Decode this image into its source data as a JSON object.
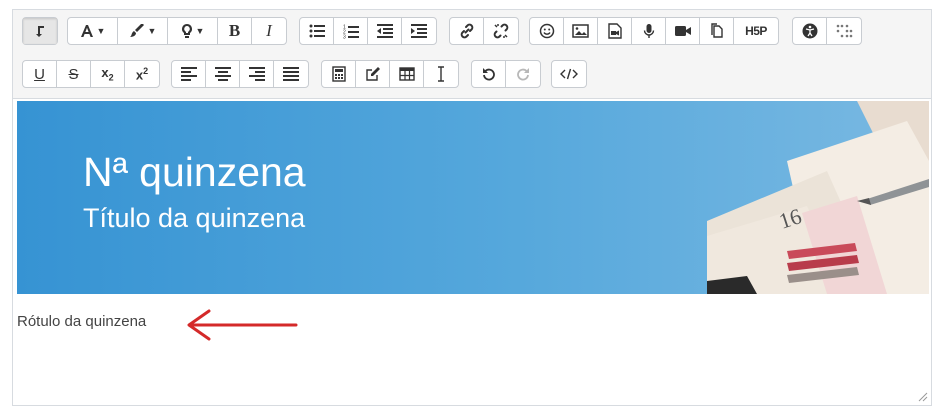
{
  "toolbar": {
    "row1": [
      {
        "name": "toolbar-toggle-button",
        "icon": "toolbar-toggle-icon",
        "pressed": true
      },
      {
        "name": "font-color-button",
        "icon": "font-color-icon"
      },
      {
        "name": "background-color-button",
        "icon": "paintbrush-icon"
      },
      {
        "name": "styles-button",
        "icon": "lightbulb-icon"
      },
      {
        "name": "bold-button",
        "icon": "bold-icon"
      },
      {
        "name": "italic-button",
        "icon": "italic-icon"
      },
      {
        "name": "unordered-list-button",
        "icon": "bullet-list-icon"
      },
      {
        "name": "ordered-list-button",
        "icon": "numbered-list-icon"
      },
      {
        "name": "outdent-button",
        "icon": "outdent-icon"
      },
      {
        "name": "indent-button",
        "icon": "indent-icon"
      },
      {
        "name": "link-button",
        "icon": "link-icon"
      },
      {
        "name": "unlink-button",
        "icon": "unlink-icon"
      },
      {
        "name": "emoji-button",
        "icon": "smiley-icon"
      },
      {
        "name": "image-button",
        "icon": "image-icon"
      },
      {
        "name": "media-button",
        "icon": "media-file-icon"
      },
      {
        "name": "record-audio-button",
        "icon": "microphone-icon"
      },
      {
        "name": "record-video-button",
        "icon": "video-camera-icon"
      },
      {
        "name": "manage-files-button",
        "icon": "copy-files-icon"
      },
      {
        "name": "h5p-button",
        "icon": "h5p-icon",
        "label": "H5P"
      },
      {
        "name": "accessibility-checker-button",
        "icon": "accessibility-icon"
      },
      {
        "name": "screenreader-helper-button",
        "icon": "braille-icon"
      }
    ],
    "row2": [
      {
        "name": "underline-button",
        "icon": "underline-icon"
      },
      {
        "name": "strikethrough-button",
        "icon": "strikethrough-icon"
      },
      {
        "name": "subscript-button",
        "icon": "subscript-icon"
      },
      {
        "name": "superscript-button",
        "icon": "superscript-icon"
      },
      {
        "name": "align-left-button",
        "icon": "align-left-icon"
      },
      {
        "name": "align-center-button",
        "icon": "align-center-icon"
      },
      {
        "name": "align-right-button",
        "icon": "align-right-icon"
      },
      {
        "name": "justify-button",
        "icon": "justify-icon"
      },
      {
        "name": "equation-editor-button",
        "icon": "calculator-icon"
      },
      {
        "name": "special-characters-button",
        "icon": "pencil-square-icon"
      },
      {
        "name": "table-button",
        "icon": "table-icon"
      },
      {
        "name": "clear-formatting-button",
        "icon": "text-cursor-icon"
      },
      {
        "name": "undo-button",
        "icon": "undo-icon"
      },
      {
        "name": "redo-button",
        "icon": "redo-icon",
        "disabled": true
      },
      {
        "name": "html-button",
        "icon": "code-icon"
      }
    ]
  },
  "banner": {
    "title": "Nª quinzena",
    "subtitle": "Título da quinzena",
    "gradient_start": "#3693d3",
    "gradient_end": "#7ab9e2"
  },
  "content": {
    "label": "Rótulo da quinzena",
    "annotation_arrow_color": "#d42a2a"
  }
}
